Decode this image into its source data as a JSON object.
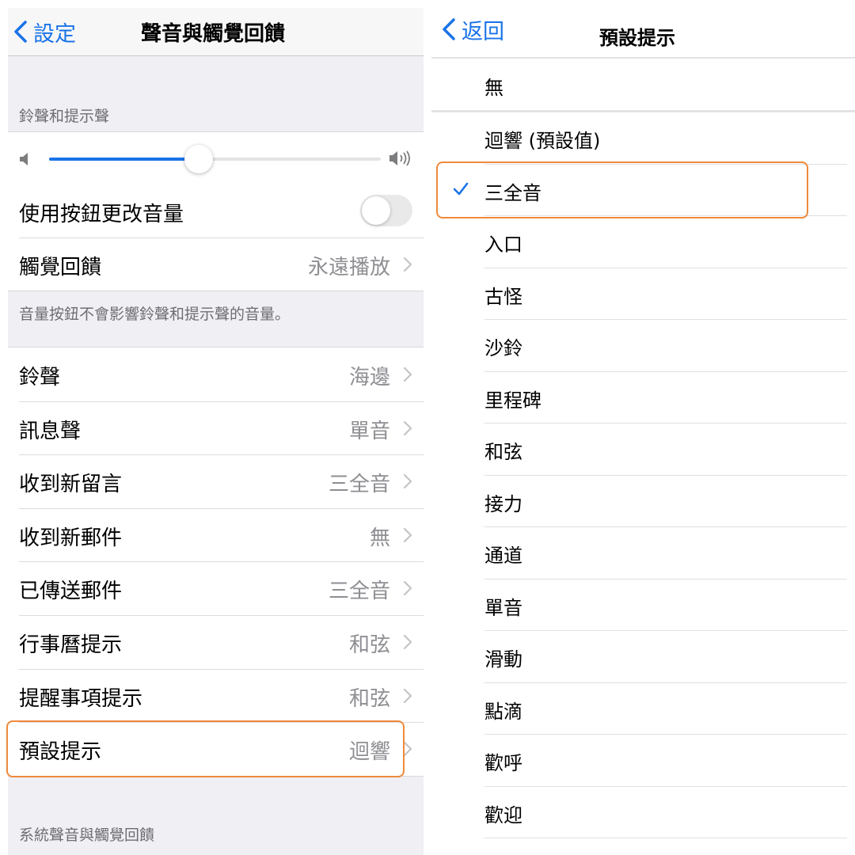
{
  "left": {
    "back_label": "設定",
    "title": "聲音與觸覺回饋",
    "section1_header": "鈴聲和提示聲",
    "volume_level": 0.45,
    "change_with_buttons": {
      "label": "使用按鈕更改音量",
      "on": false
    },
    "haptics": {
      "label": "觸覺回饋",
      "value": "永遠播放"
    },
    "footer_note": "音量按鈕不會影響鈴聲和提示聲的音量。",
    "sound_rows": [
      {
        "label": "鈴聲",
        "value": "海邊"
      },
      {
        "label": "訊息聲",
        "value": "單音"
      },
      {
        "label": "收到新留言",
        "value": "三全音"
      },
      {
        "label": "收到新郵件",
        "value": "無"
      },
      {
        "label": "已傳送郵件",
        "value": "三全音"
      },
      {
        "label": "行事曆提示",
        "value": "和弦"
      },
      {
        "label": "提醒事項提示",
        "value": "和弦"
      },
      {
        "label": "預設提示",
        "value": "迴響"
      }
    ],
    "section3_header": "系統聲音與觸覺回饋"
  },
  "right": {
    "back_label": "返回",
    "title": "預設提示",
    "none_option": "無",
    "options": [
      "迴響 (預設值)",
      "三全音",
      "入口",
      "古怪",
      "沙鈴",
      "里程碑",
      "和弦",
      "接力",
      "通道",
      "單音",
      "滑動",
      "點滴",
      "歡呼",
      "歡迎"
    ],
    "selected_index": 1
  },
  "colors": {
    "accent": "#1a73e8",
    "highlight": "#ee8a3c"
  }
}
